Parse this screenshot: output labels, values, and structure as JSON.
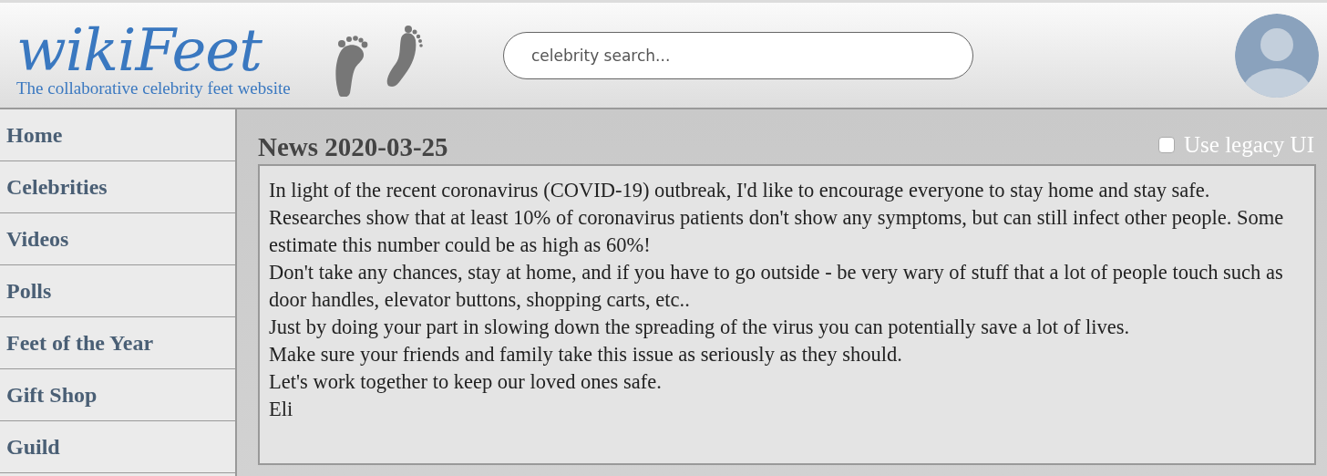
{
  "header": {
    "logo": "wikiFeet",
    "tagline": "The collaborative celebrity feet website",
    "search": {
      "placeholder": "celebrity search..."
    }
  },
  "sidebar": {
    "items": [
      {
        "label": "Home"
      },
      {
        "label": "Celebrities"
      },
      {
        "label": "Videos"
      },
      {
        "label": "Polls"
      },
      {
        "label": "Feet of the Year"
      },
      {
        "label": "Gift Shop"
      },
      {
        "label": "Guild"
      }
    ]
  },
  "news": {
    "title": "News 2020-03-25",
    "legacy_ui": {
      "label": "Use legacy UI",
      "checked": false
    },
    "paragraphs": [
      "In light of the recent coronavirus (COVID-19) outbreak, I'd like to encourage everyone to stay home and stay safe.",
      "Researches show that at least 10% of coronavirus patients don't show any symptoms, but can still infect other people. Some estimate this number could be as high as 60%!",
      "Don't take any chances, stay at home, and if you have to go outside - be very wary of stuff that a lot of people touch such as door handles, elevator buttons, shopping carts, etc..",
      "Just by doing your part in slowing down the spreading of the virus you can potentially save a lot of lives.",
      "Make sure your friends and family take this issue as seriously as they should.",
      "Let's work together to keep our loved ones safe.",
      "Eli"
    ]
  }
}
